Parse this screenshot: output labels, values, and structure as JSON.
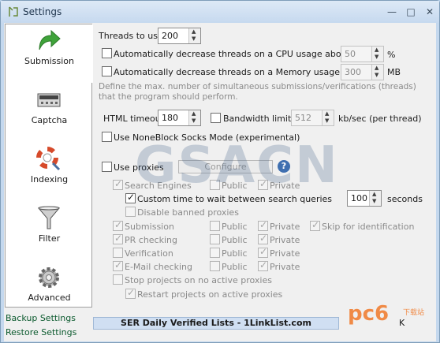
{
  "window": {
    "title": "Settings",
    "minimize": "—",
    "maximize": "□",
    "close": "✕"
  },
  "sidebar": {
    "items": [
      {
        "label": "Submission",
        "icon": "green-arrow-icon"
      },
      {
        "label": "Captcha",
        "icon": "captcha-box-icon"
      },
      {
        "label": "Indexing",
        "icon": "lifebuoy-icon"
      },
      {
        "label": "Filter",
        "icon": "funnel-icon"
      },
      {
        "label": "Advanced",
        "icon": "gear-icon"
      }
    ],
    "backup_link": "Backup Settings",
    "restore_link": "Restore Settings"
  },
  "threads": {
    "label": "Threads to use",
    "value": "200"
  },
  "cpu": {
    "label": "Automatically decrease threads on a CPU usage above",
    "value": "50",
    "unit": "%"
  },
  "memory": {
    "label": "Automatically decrease threads on a Memory usage above",
    "value": "300",
    "unit": "MB"
  },
  "description": "Define the max. number of simultaneous submissions/verifications (threads) that the program should perform.",
  "html_timeout": {
    "label": "HTML timeout",
    "value": "180"
  },
  "bandwidth": {
    "label": "Bandwidth limit",
    "value": "512",
    "unit": "kb/sec (per thread)"
  },
  "noneblock": {
    "label": "Use NoneBlock Socks Mode (experimental)"
  },
  "proxies": {
    "label": "Use proxies",
    "configure": "Configure",
    "help": "?"
  },
  "proxy_options": {
    "search_engines": "Search Engines",
    "public": "Public",
    "private": "Private",
    "custom_time": "Custom time to wait between search queries",
    "custom_time_value": "100",
    "custom_time_unit": "seconds",
    "disable_banned": "Disable banned proxies",
    "submission": "Submission",
    "skip_identification": "Skip for identification",
    "pr_checking": "PR checking",
    "verification": "Verification",
    "email_checking": "E-Mail checking",
    "stop_projects": "Stop projects on no active proxies",
    "restart_projects": "Restart projects on active proxies"
  },
  "banner": "SER Daily Verified Lists - 1LinkList.com",
  "ok_button": "K",
  "watermark": "GSACN",
  "brand": {
    "mark": "pc6",
    "sub": "下载站"
  }
}
